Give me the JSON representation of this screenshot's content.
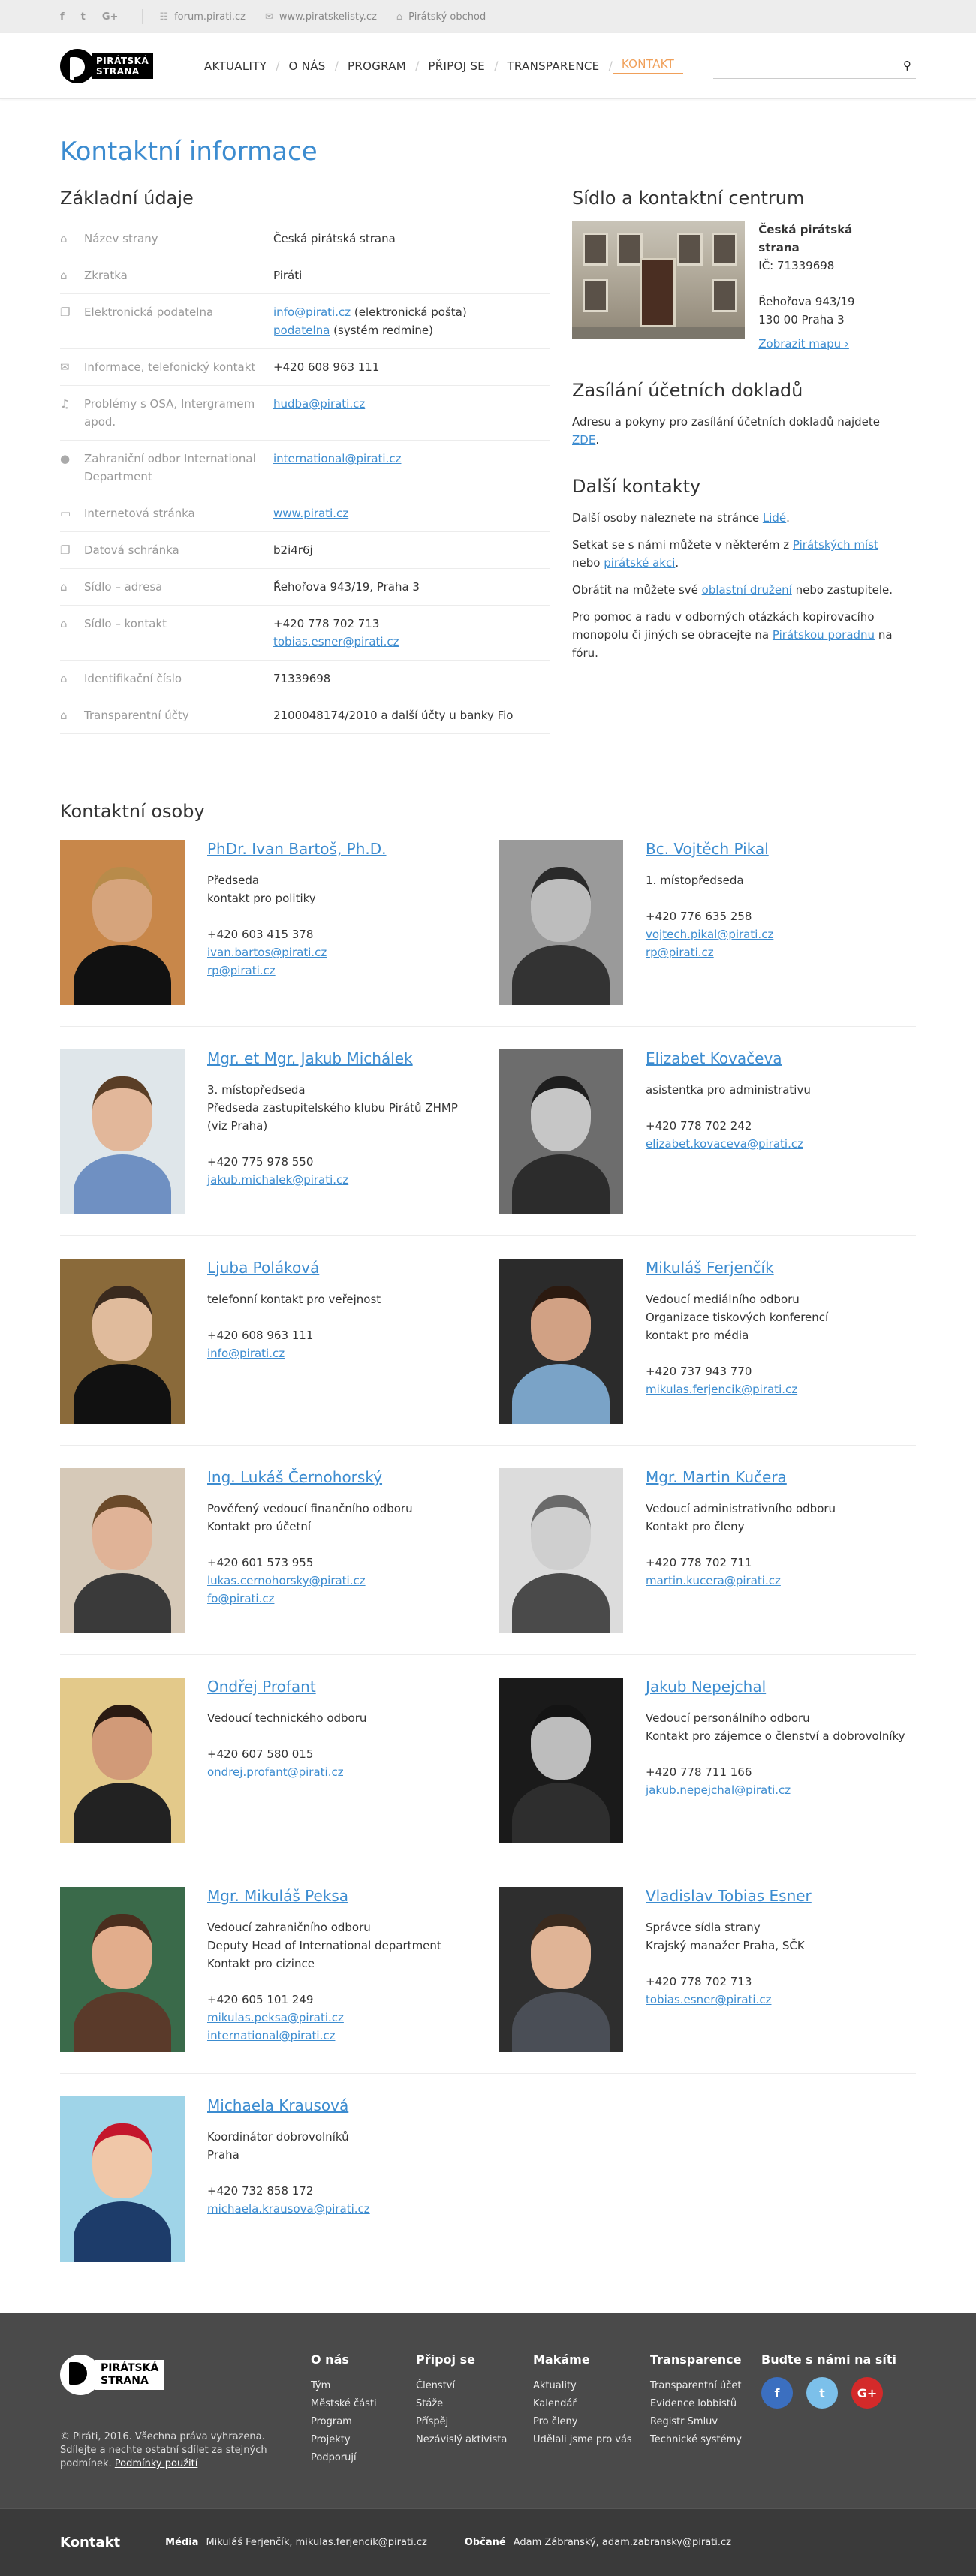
{
  "topbar": {
    "social": [
      "f",
      "t",
      "G+"
    ],
    "links": [
      {
        "icon": "chat-icon",
        "glyph": "☷",
        "label": "forum.pirati.cz"
      },
      {
        "icon": "mail-icon",
        "glyph": "✉",
        "label": "www.piratskelisty.cz"
      },
      {
        "icon": "shop-icon",
        "glyph": "⌂",
        "label": "Pirátský obchod"
      }
    ]
  },
  "logo": {
    "line1": "PIRÁTSKÁ",
    "line2": "STRANA"
  },
  "nav": {
    "items": [
      "AKTUALITY",
      "O NÁS",
      "PROGRAM",
      "PŘIPOJ SE",
      "TRANSPARENCE",
      "KONTAKT"
    ],
    "active": "KONTAKT",
    "search_glyph": "⚲"
  },
  "page": {
    "title": "Kontaktní informace",
    "basic_heading": "Základní údaje",
    "basic": [
      {
        "icon": "building-icon",
        "glyph": "⌂",
        "label": "Název strany",
        "value": "Česká pirátská strana"
      },
      {
        "icon": "building-icon",
        "glyph": "⌂",
        "label": "Zkratka",
        "value": "Piráti"
      },
      {
        "icon": "copy-icon",
        "glyph": "❐",
        "label": "Elektronická podatelna",
        "links": [
          "info@pirati.cz",
          "podatelna"
        ],
        "suffixes": [
          " (elektronická pošta)",
          " (systém redmine)"
        ]
      },
      {
        "icon": "envelope-icon",
        "glyph": "✉",
        "label": "Informace, telefonický kontakt",
        "value": "+420 608 963 111"
      },
      {
        "icon": "music-icon",
        "glyph": "♫",
        "label": "Problémy s OSA, Intergramem apod.",
        "links": [
          "hudba@pirati.cz"
        ]
      },
      {
        "icon": "globe-icon",
        "glyph": "●",
        "label": "Zahraniční odbor International Department",
        "links": [
          "international@pirati.cz"
        ]
      },
      {
        "icon": "monitor-icon",
        "glyph": "▭",
        "label": "Internetová stránka",
        "links": [
          "www.pirati.cz"
        ]
      },
      {
        "icon": "copy-icon",
        "glyph": "❐",
        "label": "Datová schránka",
        "value": "b2i4r6j"
      },
      {
        "icon": "building-icon",
        "glyph": "⌂",
        "label": "Sídlo – adresa",
        "value": "Řehořova 943/19, Praha 3"
      },
      {
        "icon": "building-icon",
        "glyph": "⌂",
        "label": "Sídlo – kontakt",
        "value": "+420 778 702 713",
        "links": [
          "tobias.esner@pirati.cz"
        ]
      },
      {
        "icon": "building-icon",
        "glyph": "⌂",
        "label": "Identifikační číslo",
        "value": "71339698"
      },
      {
        "icon": "building-icon",
        "glyph": "⌂",
        "label": "Transparentní účty",
        "value": "2100048174/2010 a další účty u banky Fio"
      }
    ],
    "hq": {
      "heading": "Sídlo a kontaktní centrum",
      "name": "Česká pirátská strana",
      "ic": "IČ: 71339698",
      "street": "Řehořova 943/19",
      "city": "130 00  Praha 3",
      "map_link": "Zobrazit mapu ›"
    },
    "docs": {
      "heading": "Zasílání účetních dokladů",
      "text": "Adresu a pokyny pro zasílání účetních dokladů najdete ",
      "link": "ZDE",
      "end": "."
    },
    "other": {
      "heading": "Další kontakty",
      "p1": "Další osoby naleznete na stránce ",
      "p1_link": "Lidé",
      "p2a": "Setkat se s námi můžete v některém z ",
      "p2_link1": "Pirátských míst",
      "p2b": " nebo ",
      "p2_link2": "pirátské akci",
      "p3a": "Obrátit na můžete své ",
      "p3_link": "oblastní družení",
      "p3b": " nebo zastupitele.",
      "p4": "Pro pomoc a radu v odborných otázkách kopirovacího monopolu či jiných se obracejte na ",
      "p4_link": "Pirátskou poradnu",
      "p4b": " na fóru."
    }
  },
  "contacts": {
    "heading": "Kontaktní osoby",
    "people": [
      {
        "name": "PhDr. Ivan Bartoš, Ph.D.",
        "role": [
          "Předseda",
          "kontakt pro politiky"
        ],
        "phone": "+420 603 415 378",
        "links": [
          "ivan.bartos@pirati.cz",
          "rp@pirati.cz"
        ],
        "bg": "#c8874a",
        "skin": "#d6a47c",
        "hair": "#b88b4a",
        "shirt": "#111111"
      },
      {
        "name": "Bc. Vojtěch Pikal",
        "role": [
          "1. místopředseda"
        ],
        "phone": "+420 776 635 258",
        "links": [
          "vojtech.pikal@pirati.cz",
          "rp@pirati.cz"
        ],
        "bg": "#9a9a9a",
        "skin": "#bdbdbd",
        "hair": "#2a2a2a",
        "shirt": "#333333"
      },
      {
        "name": "Mgr. et Mgr. Jakub Michálek",
        "role": [
          "3. místopředseda",
          "Předseda zastupitelského klubu Pirátů ZHMP (viz Praha)"
        ],
        "phone": "+420 775 978 550",
        "links": [
          "jakub.michalek@pirati.cz"
        ],
        "bg": "#dfe6ea",
        "skin": "#e2b79a",
        "hair": "#5a3e26",
        "shirt": "#6f90c2"
      },
      {
        "name": "Elizabet Kovačeva",
        "role": [
          "asistentka pro administrativu"
        ],
        "phone": "+420 778 702 242",
        "links": [
          "elizabet.kovaceva@pirati.cz"
        ],
        "bg": "#6d6d6d",
        "skin": "#c6c6c6",
        "hair": "#1e1e1e",
        "shirt": "#2c2c2c"
      },
      {
        "name": "Ljuba Poláková",
        "role": [
          "telefonní kontakt pro veřejnost"
        ],
        "phone": "+420 608 963 111",
        "links": [
          "info@pirati.cz"
        ],
        "bg": "#8a6a3a",
        "skin": "#e0bb9c",
        "hair": "#3a2a1e",
        "shirt": "#111111"
      },
      {
        "name": "Mikuláš Ferjenčík",
        "role": [
          "Vedoucí mediálního odboru",
          "Organizace tiskových konferencí",
          "kontakt pro média"
        ],
        "phone": "+420 737 943 770",
        "links": [
          "mikulas.ferjencik@pirati.cz"
        ],
        "bg": "#2b2b2b",
        "skin": "#d1a184",
        "hair": "#2b1a10",
        "shirt": "#7aa3c7"
      },
      {
        "name": "Ing. Lukáš Černohorský",
        "role": [
          "Pověřený vedoucí finančního odboru",
          "Kontakt pro účetní"
        ],
        "phone": "+420 601 573 955",
        "links": [
          "lukas.cernohorsky@pirati.cz",
          "fo@pirati.cz"
        ],
        "bg": "#d6c9b8",
        "skin": "#e0b397",
        "hair": "#6b4a2a",
        "shirt": "#3a3a3a"
      },
      {
        "name": "Mgr. Martin Kučera",
        "role": [
          "Vedoucí administrativního odboru",
          "Kontakt pro členy"
        ],
        "phone": "+420 778 702 711",
        "links": [
          "martin.kucera@pirati.cz"
        ],
        "bg": "#dcdcdc",
        "skin": "#cfcfcf",
        "hair": "#6a6a6a",
        "shirt": "#4a4a4a"
      },
      {
        "name": "Ondřej Profant",
        "role": [
          "Vedoucí technického odboru"
        ],
        "phone": "+420 607 580 015",
        "links": [
          "ondrej.profant@pirati.cz"
        ],
        "bg": "#e3c98a",
        "skin": "#d19a78",
        "hair": "#2a1a12",
        "shirt": "#222222"
      },
      {
        "name": "Jakub Nepejchal",
        "role": [
          "Vedoucí personálního odboru",
          "Kontakt pro zájemce o členství a dobrovolníky"
        ],
        "phone": "+420 778 711 166",
        "links": [
          "jakub.nepejchal@pirati.cz"
        ],
        "bg": "#1a1a1a",
        "skin": "#bdbdbd",
        "hair": "#141414",
        "shirt": "#2e2e2e"
      },
      {
        "name": "Mgr. Mikuláš Peksa",
        "role": [
          "Vedoucí zahraničního odboru",
          "Deputy Head of International department",
          "Kontakt pro cizince"
        ],
        "phone": "+420 605 101 249",
        "links": [
          "mikulas.peksa@pirati.cz",
          "international@pirati.cz"
        ],
        "bg": "#3a6a4a",
        "skin": "#e2ad8c",
        "hair": "#4a2e1e",
        "shirt": "#5a3a2a"
      },
      {
        "name": "Vladislav Tobias Esner",
        "role": [
          "Správce sídla strany",
          "Krajský manažer Praha, SČK"
        ],
        "phone": "+420 778 702 713",
        "links": [
          "tobias.esner@pirati.cz"
        ],
        "bg": "#2e2e2e",
        "skin": "#e0b496",
        "hair": "#3a2a1e",
        "shirt": "#4a4e56"
      },
      {
        "name": "Michaela Krausová",
        "role": [
          "Koordinátor dobrovolníků",
          "Praha"
        ],
        "phone": "+420 732 858 172",
        "links": [
          "michaela.krausova@pirati.cz"
        ],
        "bg": "#9fd4e8",
        "skin": "#f0c7a8",
        "hair": "#c4162c",
        "shirt": "#1d3c6a"
      }
    ]
  },
  "footer": {
    "logo": {
      "line1": "PIRÁTSKÁ",
      "line2": "STRANA"
    },
    "copyright": "© Piráti, 2016. Všechna práva vyhrazena. Sdílejte a nechte ostatní sdílet za stejných podmínek. ",
    "conditions_link": "Podmínky použití",
    "columns": [
      {
        "title": "O nás",
        "links": [
          "Tým",
          "Městské části",
          "Program",
          "Projekty",
          "Podporují"
        ]
      },
      {
        "title": "Připoj se",
        "links": [
          "Členství",
          "Stáže",
          "Příspěj",
          "Nezávislý aktivista"
        ]
      },
      {
        "title": "Makáme",
        "links": [
          "Aktuality",
          "Kalendář",
          "Pro členy",
          "Udělali jsme pro vás"
        ]
      },
      {
        "title": "Transparence",
        "links": [
          "Transparentní účet",
          "Evidence lobbistů",
          "Registr Smluv",
          "Technické systémy"
        ]
      }
    ],
    "social_title": "Buďte s námi na síti",
    "social": [
      {
        "icon": "facebook-icon",
        "glyph": "f",
        "color": "#3b6fc0"
      },
      {
        "icon": "twitter-icon",
        "glyph": "t",
        "color": "#7cc0ea"
      },
      {
        "icon": "google-plus-icon",
        "glyph": "G+",
        "color": "#d42a2a"
      }
    ]
  },
  "bottombar": {
    "title": "Kontakt",
    "media_label": "Média",
    "media_value": "Mikuláš Ferjenčík, mikulas.ferjencik@pirati.cz",
    "citizens_label": "Občané",
    "citizens_value": "Adam Zábranský, adam.zabransky@pirati.cz"
  }
}
